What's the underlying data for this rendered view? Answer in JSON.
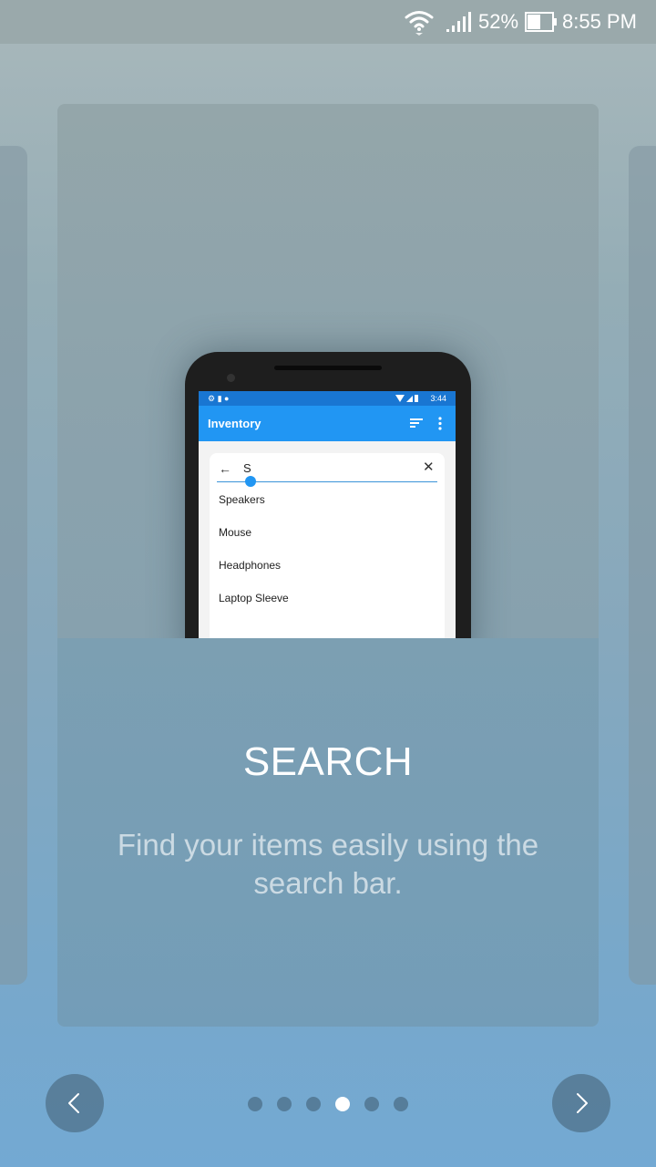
{
  "status_bar": {
    "battery_percent": "52%",
    "time": "8:55 PM",
    "icons": [
      "wifi-icon",
      "signal-icon",
      "battery-icon"
    ]
  },
  "slide": {
    "title": "SEARCH",
    "description": "Find your items easily using the search bar."
  },
  "mockup": {
    "status_time": "3:44",
    "app_title": "Inventory",
    "search_query": "S",
    "results": [
      "Speakers",
      "Mouse",
      "Headphones",
      "Laptop Sleeve"
    ],
    "accent_color": "#2196f3"
  },
  "navigation": {
    "page_count": 6,
    "current_page": 4,
    "prev_icon": "chevron-left-icon",
    "next_icon": "chevron-right-icon"
  }
}
